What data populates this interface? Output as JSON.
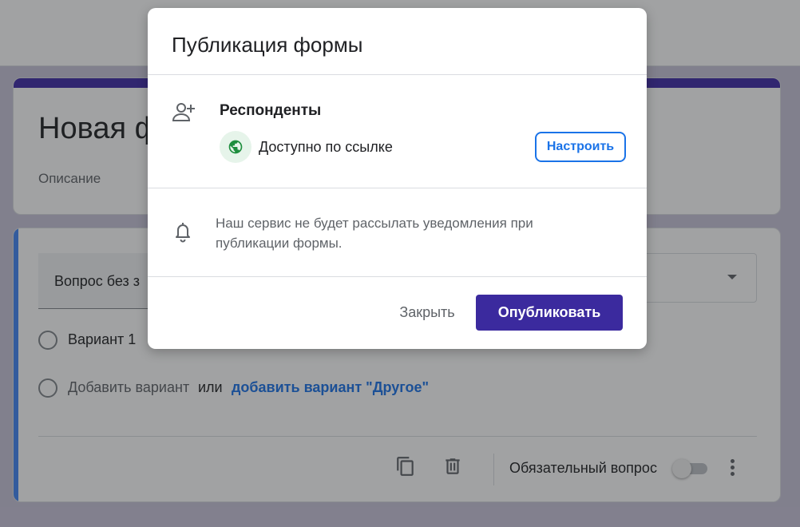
{
  "background": {
    "form_title": "Новая ф",
    "form_description": "Описание",
    "question": {
      "title": "Вопрос без з",
      "options": [
        {
          "label": "Вариант 1"
        }
      ],
      "add_option": "Добавить вариант",
      "or": "или",
      "add_other": "добавить вариант \"Другое\"",
      "required_label": "Обязательный вопрос"
    }
  },
  "dialog": {
    "title": "Публикация формы",
    "respondents": {
      "title": "Респонденты",
      "access": "Доступно по ссылке",
      "configure_button": "Настроить"
    },
    "notice": "Наш сервис не будет рассылать уведомления при публикации формы.",
    "close_button": "Закрыть",
    "publish_button": "Опубликовать"
  },
  "colors": {
    "accent": "#3f2aa8",
    "link": "#1a73e8",
    "question_accent": "#4285f4",
    "globe": "#1e8e3e",
    "globe_bg": "#e6f4ea"
  },
  "icons": [
    "person-add-icon",
    "globe-icon",
    "bell-icon",
    "copy-icon",
    "trash-icon",
    "more-vert-icon",
    "dropdown-caret-icon"
  ]
}
